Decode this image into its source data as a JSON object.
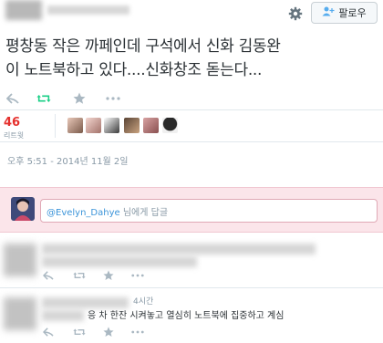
{
  "tweet": {
    "follow_label": "팔로우",
    "text_line1": "평창동 작은 까페인데 구석에서 신화 김동완",
    "text_line2": "이 노트북하고 있다....신화창조 돋는다...",
    "retweets": {
      "count": "46",
      "label": "리트윗"
    },
    "timestamp": "오후 5:51 - 2014년 11월 2일",
    "icons": [
      "gear-icon",
      "follow-person-plus-icon",
      "reply-icon",
      "retweet-icon",
      "favorite-star-icon",
      "more-dots-icon"
    ]
  },
  "reply": {
    "mention": "@Evelyn_Dahye",
    "suffix": " 님에게 답글"
  },
  "comments": [
    {
      "time": "",
      "text": ""
    },
    {
      "time": "4시간",
      "text": "응 차 한잔 시켜놓고 열심히 노트북에 집중하고 계심"
    }
  ],
  "colors": {
    "accent": "#e5302d",
    "retweet_green": "#19cf86",
    "reply_bg": "#fbe5ea",
    "link": "#3b94d9"
  }
}
